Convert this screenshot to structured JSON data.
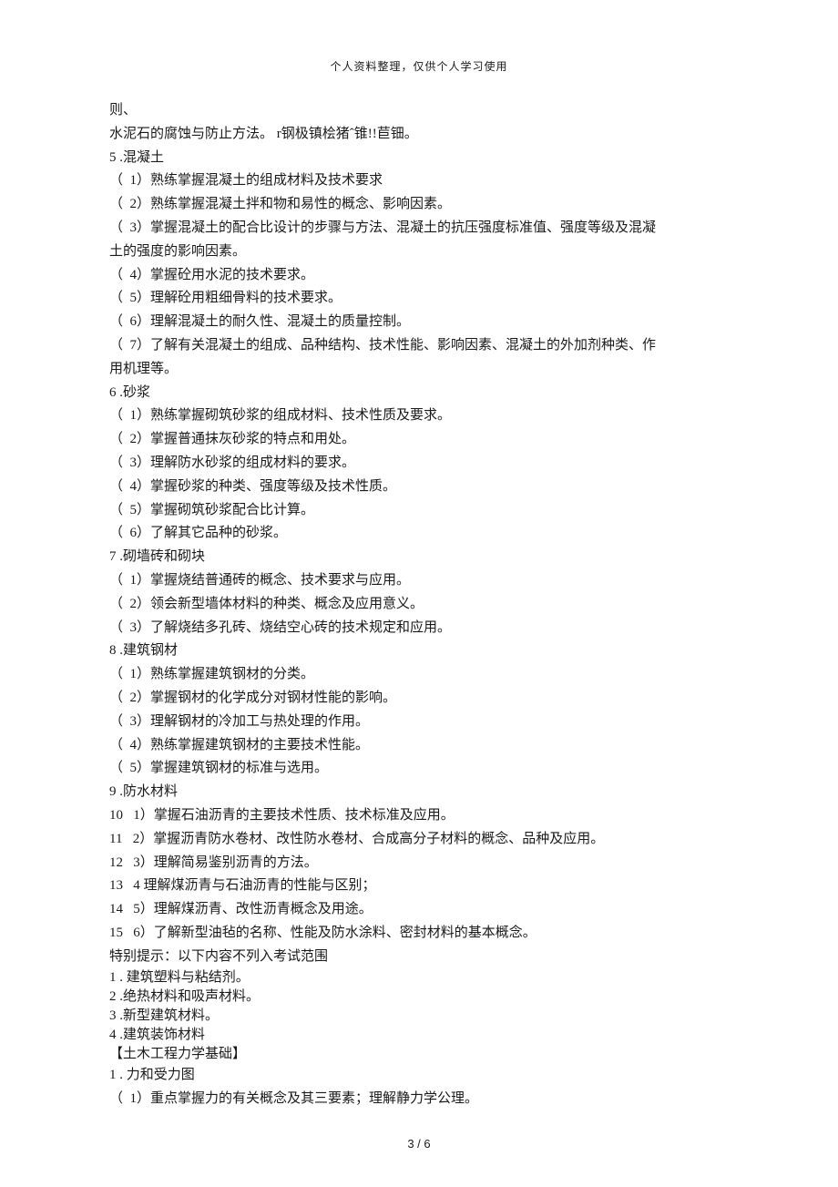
{
  "header": "个人资料整理，仅供个人学习使用",
  "footer": "3 / 6",
  "lines": [
    {
      "t": "则、"
    },
    {
      "t": "水泥石的腐蚀与防止方法。 r钢极镇桧猪ˆ锥!!苣钿。"
    },
    {
      "t": "5 .混凝土"
    },
    {
      "t": "（  1）熟练掌握混凝土的组成材料及技术要求"
    },
    {
      "t": "（  2）熟练掌握混凝土拌和物和易性的概念、影响因素。"
    },
    {
      "t": "（  3）掌握混凝土的配合比设计的步骤与方法、混凝土的抗压强度标准值、强度等级及混凝"
    },
    {
      "t": "土的强度的影响因素。"
    },
    {
      "t": "（  4）掌握砼用水泥的技术要求。"
    },
    {
      "t": "（  5）理解砼用粗细骨料的技术要求。"
    },
    {
      "t": "（  6）理解混凝土的耐久性、混凝土的质量控制。"
    },
    {
      "t": "（  7）了解有关混凝土的组成、品种结构、技术性能、影响因素、混凝土的外加剂种类、作"
    },
    {
      "t": "用机理等。"
    },
    {
      "t": "6 .砂浆"
    },
    {
      "t": "（  1）熟练掌握砌筑砂浆的组成材料、技术性质及要求。"
    },
    {
      "t": "（  2）掌握普通抹灰砂浆的特点和用处。"
    },
    {
      "t": "（  3）理解防水砂浆的组成材料的要求。"
    },
    {
      "t": "（  4）掌握砂浆的种类、强度等级及技术性质。"
    },
    {
      "t": "（  5）掌握砌筑砂浆配合比计算。"
    },
    {
      "t": "（  6）了解其它品种的砂浆。"
    },
    {
      "t": "7 .砌墙砖和砌块"
    },
    {
      "t": "（  1）掌握烧结普通砖的概念、技术要求与应用。"
    },
    {
      "t": "（  2）领会新型墙体材料的种类、概念及应用意义。"
    },
    {
      "t": "（  3）了解烧结多孔砖、烧结空心砖的技术规定和应用。"
    },
    {
      "t": "8 .建筑钢材"
    },
    {
      "t": "（  1）熟练掌握建筑钢材的分类。"
    },
    {
      "t": "（  2）掌握钢材的化学成分对钢材性能的影响。"
    },
    {
      "t": "（  3）理解钢材的冷加工与热处理的作用。"
    },
    {
      "t": "（  4）熟练掌握建筑钢材的主要技术性能。"
    },
    {
      "t": "（  5）掌握建筑钢材的标准与选用。"
    },
    {
      "t": "9 .防水材料"
    },
    {
      "t": "10   1）掌握石油沥青的主要技术性质、技术标准及应用。"
    },
    {
      "t": "11   2）掌握沥青防水卷材、改性防水卷材、合成高分子材料的概念、品种及应用。"
    },
    {
      "t": "12   3）理解简易鉴别沥青的方法。"
    },
    {
      "t": "13   4 理解煤沥青与石油沥青的性能与区别；"
    },
    {
      "t": "14   5）理解煤沥青、改性沥青概念及用途。"
    },
    {
      "t": "15   6）了解新型油毡的名称、性能及防水涂料、密封材料的基本概念。"
    },
    {
      "t": "特别提示：以下内容不列入考试范围"
    },
    {
      "t": "1 . 建筑塑料与粘结剂。",
      "tight": true
    },
    {
      "t": "2 .绝热材料和吸声材料。",
      "tight": true
    },
    {
      "t": "3 .新型建筑材料。",
      "tight": true
    },
    {
      "t": "4 .建筑装饰材料",
      "tight": true
    },
    {
      "t": "【土木工程力学基础】",
      "tight": true
    },
    {
      "t": "1 . 力和受力图"
    },
    {
      "t": "（  1）重点掌握力的有关概念及其三要素；理解静力学公理。"
    }
  ]
}
